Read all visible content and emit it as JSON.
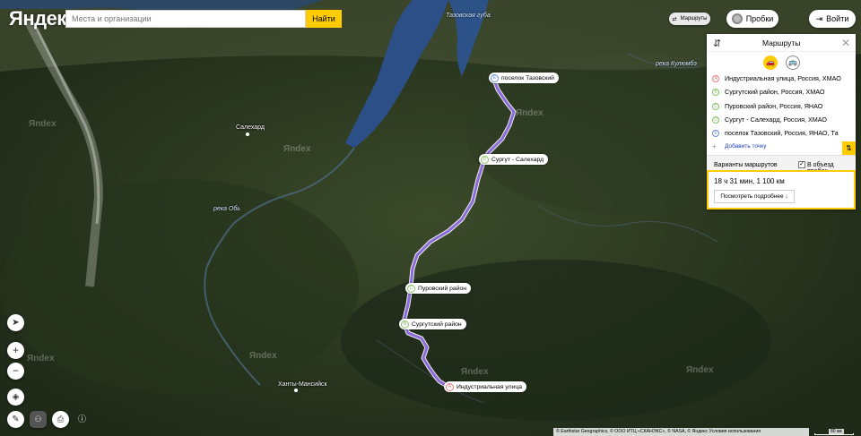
{
  "brand": {
    "logo_text": "Яндекс"
  },
  "search": {
    "placeholder": "Места и организации",
    "button_label": "Найти"
  },
  "top_controls": {
    "routes_label": "Маршруты",
    "traffic_label": "Пробки",
    "login_label": "Войти"
  },
  "route_panel": {
    "title": "Маршруты",
    "mode": "car",
    "waypoints": [
      {
        "letter": "A",
        "text": "Индустриальная улица, Россия, ХМАО",
        "color": "#e87b7b"
      },
      {
        "letter": "B",
        "text": "Сургутский район, Россия, ХМАО",
        "color": "#8ac16a"
      },
      {
        "letter": "C",
        "text": "Пуровский район, Россия, ЯНАО",
        "color": "#8ac16a"
      },
      {
        "letter": "D",
        "text": "Сургут - Салехард, Россия, ХМАО",
        "color": "#8ac16a"
      },
      {
        "letter": "E",
        "text": "поселок Тазовский, Россия, ЯНАО, Та",
        "color": "#6d8fd6"
      }
    ],
    "add_point_label": "Добавить точку",
    "variants_label": "Варианты маршрутов",
    "avoid_traffic_label": "В объезд пробок",
    "avoid_traffic_checked": true,
    "result_summary": "18 ч 31 мин, 1 100 км",
    "details_button": "Посмотреть подробнее ↓"
  },
  "map_markers": [
    {
      "letter": "E",
      "label": "поселок Тазовский",
      "color": "#6d8fd6"
    },
    {
      "letter": "D",
      "label": "Сургут - Салехард",
      "color": "#8ac16a"
    },
    {
      "letter": "C",
      "label": "Пуровский район",
      "color": "#8ac16a"
    },
    {
      "letter": "B",
      "label": "Сургутский район",
      "color": "#8ac16a"
    },
    {
      "letter": "A",
      "label": "Индустриальная улица",
      "color": "#e87b7b"
    }
  ],
  "map_labels": {
    "taz_bay": "Тазовская губа",
    "salekhard": "Салехард",
    "ob_river": "река Обь",
    "khanty_mansiysk": "Ханты-Мансийск",
    "kulyumbe_river": "река Кулюмбэ"
  },
  "watermark_text": "Яndex",
  "attribution": "© Earthstar Geographics, © ООО ИТЦ «СКАНЭКС», © NASA, © Яндекс Условия использования",
  "scale_label": "80 км",
  "colors": {
    "route": "#8b6bd9",
    "accent": "#ffcc00"
  }
}
